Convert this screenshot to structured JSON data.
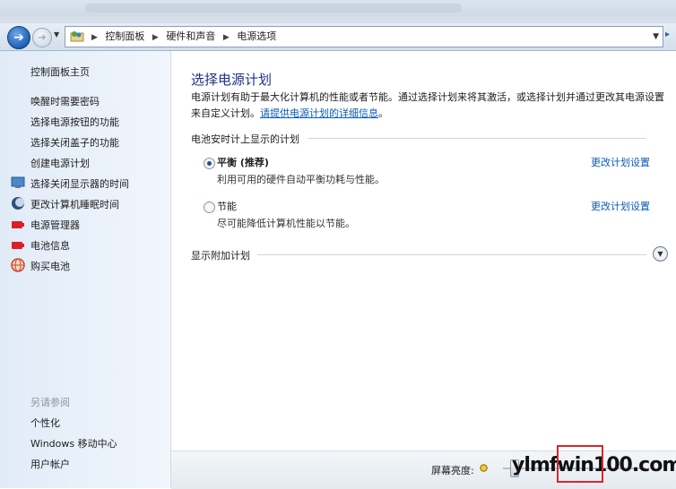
{
  "breadcrumb": [
    "控制面板",
    "硬件和声音",
    "电源选项"
  ],
  "sidebar": {
    "home": "控制面板主页",
    "items": [
      {
        "label": "唤醒时需要密码",
        "icon": ""
      },
      {
        "label": "选择电源按钮的功能",
        "icon": ""
      },
      {
        "label": "选择关闭盖子的功能",
        "icon": ""
      },
      {
        "label": "创建电源计划",
        "icon": ""
      },
      {
        "label": "选择关闭显示器的时间",
        "icon": "monitor-icon"
      },
      {
        "label": "更改计算机睡眠时间",
        "icon": "moon-icon"
      },
      {
        "label": "电源管理器",
        "icon": "battery-red-icon"
      },
      {
        "label": "电池信息",
        "icon": "battery-red-icon"
      },
      {
        "label": "购买电池",
        "icon": "globe-icon"
      }
    ],
    "see_also_title": "另请参阅",
    "see_also": [
      "个性化",
      "Windows 移动中心",
      "用户帐户"
    ]
  },
  "main": {
    "title": "选择电源计划",
    "intro_text": "电源计划有助于最大化计算机的性能或者节能。通过选择计划来将其激活，或选择计划并通过更改其电源设置来自定义计划。",
    "intro_link": "请提供电源计划的详细信息",
    "intro_end": "。",
    "group_title": "电池安时计上显示的计划",
    "plans": [
      {
        "name": "平衡 (推荐)",
        "desc": "利用可用的硬件自动平衡功耗与性能。",
        "link": "更改计划设置",
        "selected": true
      },
      {
        "name": "节能",
        "desc": "尽可能降低计算机性能以节能。",
        "link": "更改计划设置",
        "selected": false
      }
    ],
    "more_plans": "显示附加计划"
  },
  "bottom": {
    "brightness_label": "屏幕亮度:"
  },
  "watermark": "ylmfwin100.com"
}
